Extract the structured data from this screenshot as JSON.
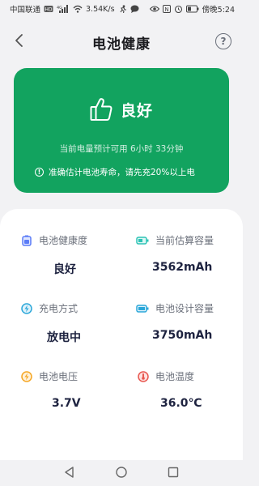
{
  "status_bar": {
    "carrier": "中国联通",
    "speed": "3.54K/s",
    "time": "傍晚5:24",
    "icons": [
      "hd-icon",
      "signal-icon",
      "wifi-icon",
      "running-icon",
      "chat-bubble-icon",
      "eye-icon",
      "nfc-icon",
      "alarm-icon",
      "battery-icon"
    ]
  },
  "header": {
    "title": "电池健康",
    "help_label": "?"
  },
  "health_card": {
    "status": "良好",
    "estimate": "当前电量预计可用 6小时 33分钟",
    "tip": "准确估计电池寿命，请先充20%以上电",
    "color": "#12a35f"
  },
  "stats": [
    {
      "label": "电池健康度",
      "value": "良好",
      "icon": "battery-health-icon",
      "color": "#5b7cf7"
    },
    {
      "label": "当前估算容量",
      "value": "3562mAh",
      "icon": "battery-level-icon",
      "color": "#2ec4b6"
    },
    {
      "label": "充电方式",
      "value": "放电中",
      "icon": "charging-icon",
      "color": "#2ba7d9"
    },
    {
      "label": "电池设计容量",
      "value": "3750mAh",
      "icon": "battery-full-icon",
      "color": "#2ba7d9"
    },
    {
      "label": "电池电压",
      "value": "3.7V",
      "icon": "voltage-icon",
      "color": "#f5a623"
    },
    {
      "label": "电池温度",
      "value": "36.0℃",
      "icon": "thermometer-icon",
      "color": "#e8564f"
    }
  ],
  "nav_bar": [
    "back-triangle-icon",
    "home-circle-icon",
    "recents-square-icon"
  ]
}
